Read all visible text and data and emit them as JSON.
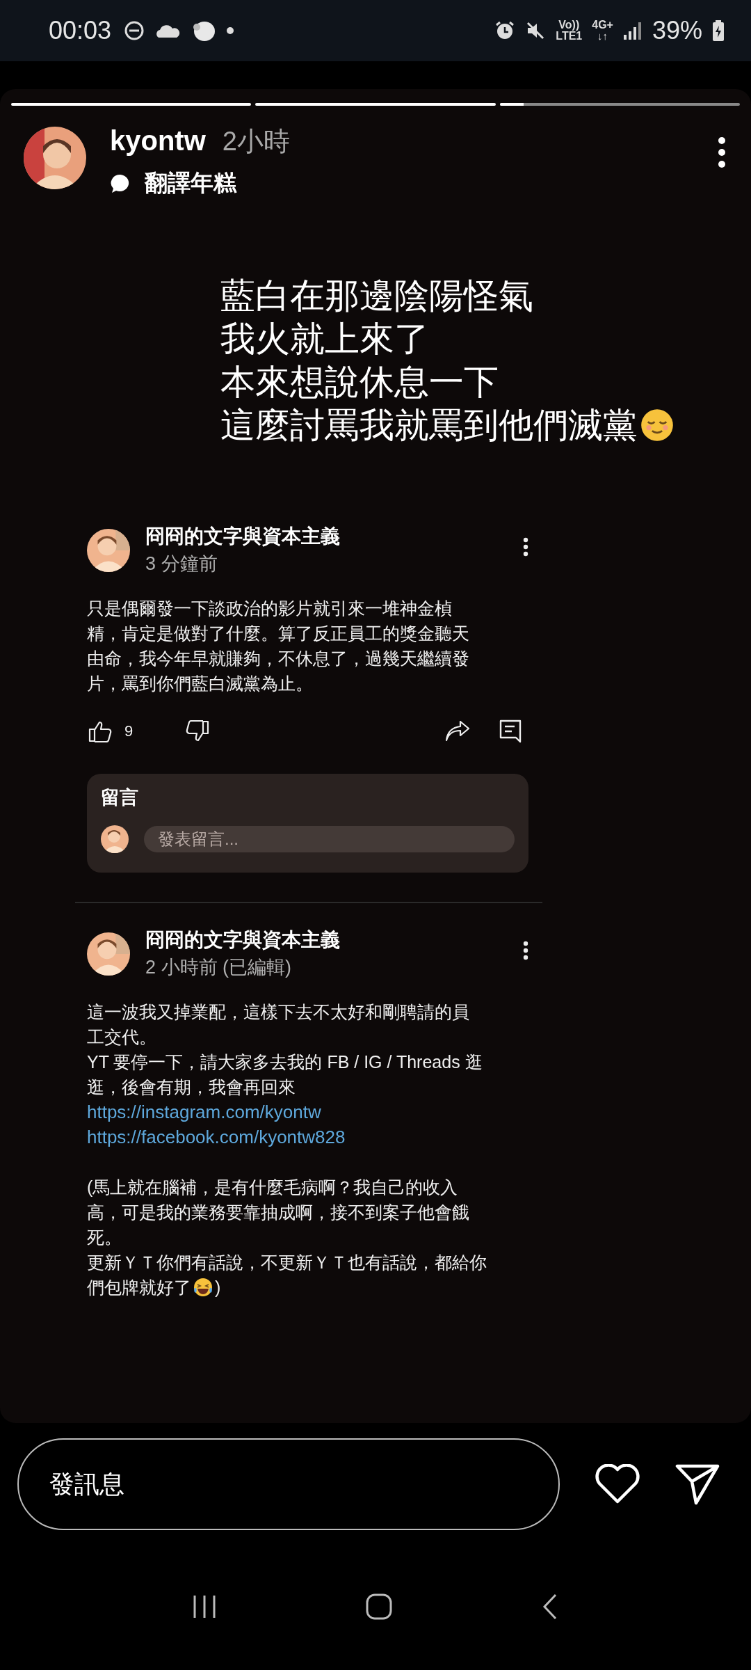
{
  "status_bar": {
    "time": "00:03",
    "volte_top": "Vo))",
    "volte_bottom": "LTE1",
    "network": "4G+",
    "network_arrows": "↓↑",
    "battery": "39%"
  },
  "story": {
    "progress": [
      {
        "level": 1
      },
      {
        "level": 1
      },
      {
        "level": 0.1
      }
    ],
    "username": "kyontw",
    "time": "2小時",
    "audio": "翻譯年糕",
    "lines": [
      {
        "text": "藍白在那邊陰陽怪氣"
      },
      {
        "text": "我火就上來了"
      },
      {
        "text": "本來想說休息一下"
      },
      {
        "text": "這麼討罵我就罵到他們滅黨",
        "end": {
          "kind": "relieved_emoji"
        }
      }
    ]
  },
  "comments": [
    {
      "author": "冏冏的文字與資本主義",
      "time": "3 分鐘前",
      "lines": [
        {
          "kind": "text",
          "text": "只是偶爾發一下談政治的影片就引來一堆神金楨"
        },
        {
          "kind": "text",
          "text": "精，肯定是做對了什麼。算了反正員工的獎金聽天"
        },
        {
          "kind": "text",
          "text": "由命，我今年早就賺夠，不休息了，過幾天繼續發"
        },
        {
          "kind": "text",
          "text": "片，罵到你們藍白滅黨為止。"
        }
      ],
      "likes": "9",
      "reply_box": {
        "title": "留言",
        "placeholder": "發表留言..."
      }
    },
    {
      "author": "冏冏的文字與資本主義",
      "time": "2 小時前 (已編輯)",
      "lines": [
        {
          "kind": "text",
          "text": "這一波我又掉業配，這樣下去不太好和剛聘請的員"
        },
        {
          "kind": "text",
          "text": "工交代。"
        },
        {
          "kind": "text",
          "text": "YT 要停一下，請大家多去我的 FB / IG / Threads 逛"
        },
        {
          "kind": "text",
          "text": "逛，後會有期，我會再回來"
        },
        {
          "kind": "link",
          "text": "https://instagram.com/kyontw"
        },
        {
          "kind": "link",
          "text": "https://facebook.com/kyontw828"
        },
        {
          "kind": "gap"
        },
        {
          "kind": "text",
          "text": "(馬上就在腦補，是有什麼毛病啊？我自己的收入"
        },
        {
          "kind": "text",
          "text": "高，可是我的業務要靠抽成啊，接不到案子他會餓"
        },
        {
          "kind": "text",
          "text": "死。"
        },
        {
          "kind": "text",
          "text": "更新ＹＴ你們有話說，不更新ＹＴ也有話說，都給你"
        },
        {
          "kind": "text",
          "text": "們包牌就好了",
          "end": {
            "kind": "laughing_emoji"
          },
          "tail": ")"
        }
      ]
    }
  ],
  "message_bar": {
    "placeholder": "發訊息"
  }
}
